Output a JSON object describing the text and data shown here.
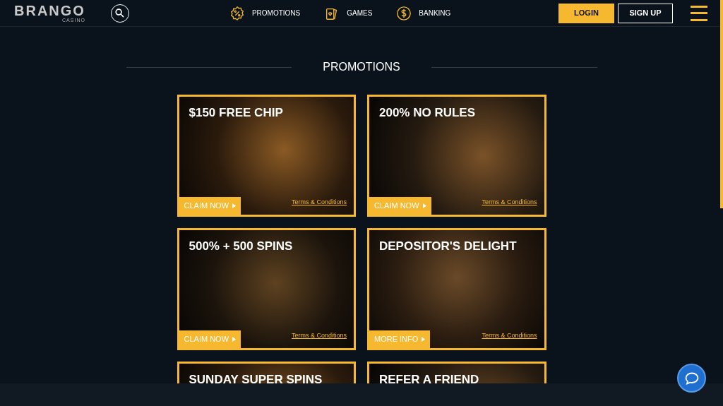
{
  "header": {
    "logo": "BRANGO",
    "logo_sub": "CASINO",
    "nav": [
      {
        "kind": "promotions",
        "label": "PROMOTIONS"
      },
      {
        "kind": "games",
        "label": "GAMES"
      },
      {
        "kind": "banking",
        "label": "BANKING"
      }
    ],
    "login": "LOGIN",
    "signup": "SIGN UP"
  },
  "section_title": "PROMOTIONS",
  "promotions": [
    {
      "title": "$150 FREE CHIP",
      "action": "CLAIM NOW",
      "terms": "Terms & Conditions"
    },
    {
      "title": "200% NO RULES",
      "action": "CLAIM NOW",
      "terms": "Terms & Conditions"
    },
    {
      "title": "500% + 500 SPINS",
      "action": "CLAIM NOW",
      "terms": "Terms & Conditions"
    },
    {
      "title": "DEPOSITOR'S DELIGHT",
      "action": "MORE INFO",
      "terms": "Terms & Conditions"
    },
    {
      "title": "SUNDAY SUPER SPINS"
    },
    {
      "title": "REFER A FRIEND"
    }
  ]
}
